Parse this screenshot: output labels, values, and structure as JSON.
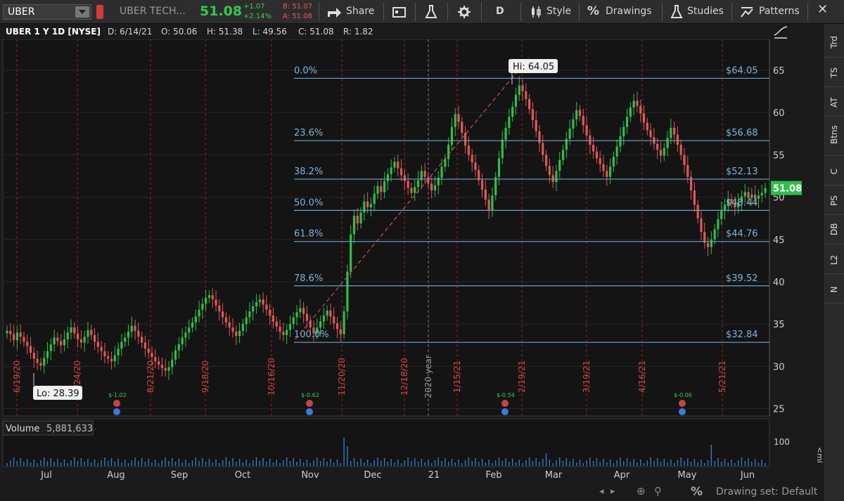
{
  "toolbar": {
    "symbol": "UBER",
    "company": "UBER TECH...",
    "last": "51.08",
    "change": "+1.07",
    "change_pct": "+2.14%",
    "bid": "B: 51.07",
    "ask": "A: 51.08",
    "share": "Share",
    "period": "D",
    "style": "Style",
    "drawings": "Drawings",
    "studies": "Studies",
    "patterns": "Patterns"
  },
  "right_tabs": [
    "Trd",
    "TS",
    "AT",
    "Btns",
    "C",
    "PS",
    "DB",
    "L2",
    "N"
  ],
  "header": {
    "title": "UBER 1 Y 1D [NYSE]",
    "date": "D: 6/14/21",
    "open": "O: 50.06",
    "high": "H: 51.38",
    "low": "L: 49.56",
    "close": "C: 51.08",
    "range": "R: 1.82"
  },
  "volume_panel": {
    "label": "Volume",
    "value": "5,881,633",
    "axis_max": "100",
    "overflow_tab": "<mi"
  },
  "footer": {
    "drawing_set": "Drawing set: Default"
  },
  "chart_data": {
    "type": "candlestick",
    "ylim": [
      24,
      69
    ],
    "y_ticks": [
      25,
      30,
      35,
      40,
      45,
      50,
      55,
      60,
      65
    ],
    "x_month_labels": [
      "Jul",
      "Aug",
      "Sep",
      "Oct",
      "Nov",
      "Dec",
      "21",
      "Feb",
      "Mar",
      "Apr",
      "May",
      "Jun"
    ],
    "vertical_date_labels": [
      "6/19/20",
      "7/24/20",
      "8/21/20",
      "9/18/20",
      "10/16/20",
      "11/20/20",
      "12/18/20",
      "2020 year",
      "1/15/21",
      "2/19/21",
      "3/19/21",
      "4/16/21",
      "5/21/21"
    ],
    "last_price_tag": "51.08",
    "hi_label": "Hi: 64.05",
    "lo_label": "Lo: 28.39",
    "fib_levels": [
      {
        "pct": "0.0%",
        "price": "$64.05",
        "value": 64.05
      },
      {
        "pct": "23.6%",
        "price": "$56.68",
        "value": 56.68
      },
      {
        "pct": "38.2%",
        "price": "$52.13",
        "value": 52.13
      },
      {
        "pct": "50.0%",
        "price": "$48.44",
        "value": 48.44
      },
      {
        "pct": "61.8%",
        "price": "$44.76",
        "value": 44.76
      },
      {
        "pct": "78.6%",
        "price": "$39.52",
        "value": 39.52
      },
      {
        "pct": "100.0%",
        "price": "$32.84",
        "value": 32.84
      }
    ],
    "earnings_markers": [
      "$-1.02",
      "$-0.62",
      "$-0.54",
      "$-0.06"
    ],
    "series_close": [
      34.2,
      33.8,
      33.1,
      34.0,
      33.5,
      32.9,
      32.4,
      31.6,
      30.9,
      30.4,
      30.1,
      31.0,
      31.8,
      32.6,
      33.4,
      33.0,
      32.5,
      33.2,
      34.0,
      34.6,
      33.9,
      33.2,
      32.8,
      33.5,
      34.3,
      33.7,
      32.9,
      32.3,
      31.8,
      31.2,
      30.9,
      30.6,
      31.3,
      32.1,
      32.9,
      33.4,
      34.1,
      34.8,
      34.2,
      33.5,
      32.8,
      32.1,
      31.6,
      31.1,
      30.6,
      30.2,
      29.8,
      29.5,
      29.9,
      30.8,
      31.9,
      32.6,
      33.4,
      34.0,
      34.6,
      35.2,
      35.9,
      36.7,
      37.4,
      38.1,
      38.4,
      37.9,
      37.2,
      36.5,
      35.8,
      35.2,
      34.6,
      34.1,
      33.6,
      34.2,
      35.0,
      35.8,
      36.5,
      37.1,
      37.6,
      37.9,
      37.3,
      36.7,
      36.0,
      35.3,
      34.7,
      34.1,
      33.7,
      34.3,
      35.0,
      35.8,
      36.4,
      36.9,
      36.2,
      35.4,
      34.6,
      33.9,
      34.6,
      35.3,
      36.0,
      36.6,
      35.9,
      35.1,
      34.4,
      33.8,
      36.5,
      41.2,
      45.6,
      47.8,
      46.9,
      48.2,
      49.5,
      48.8,
      49.2,
      50.4,
      51.3,
      50.6,
      51.9,
      52.7,
      53.5,
      54.2,
      53.4,
      52.6,
      51.9,
      51.1,
      50.5,
      51.2,
      52.0,
      53.1,
      52.4,
      51.6,
      50.8,
      51.4,
      52.3,
      53.6,
      54.5,
      56.2,
      58.3,
      59.8,
      58.9,
      57.6,
      56.1,
      55.0,
      54.1,
      53.2,
      52.0,
      50.9,
      49.7,
      48.5,
      50.2,
      52.4,
      54.6,
      56.8,
      58.2,
      59.5,
      60.7,
      62.1,
      63.2,
      62.5,
      61.6,
      60.4,
      59.1,
      57.8,
      56.4,
      55.0,
      53.7,
      52.6,
      51.8,
      53.1,
      54.4,
      55.6,
      56.9,
      58.1,
      59.2,
      60.3,
      59.6,
      58.5,
      57.3,
      56.2,
      55.4,
      54.6,
      53.9,
      53.1,
      52.4,
      53.6,
      54.8,
      56.0,
      57.2,
      58.3,
      59.5,
      60.6,
      61.4,
      60.8,
      59.9,
      58.8,
      57.9,
      57.1,
      56.3,
      55.6,
      54.9,
      55.8,
      57.0,
      58.2,
      57.4,
      56.2,
      55.0,
      53.8,
      52.4,
      50.8,
      49.1,
      47.5,
      45.9,
      44.6,
      44.1,
      45.0,
      46.2,
      47.4,
      48.4,
      49.1,
      49.8,
      49.3,
      48.8,
      49.4,
      50.1,
      50.6,
      49.9,
      50.3,
      49.8,
      50.2,
      50.5,
      51.08
    ]
  }
}
